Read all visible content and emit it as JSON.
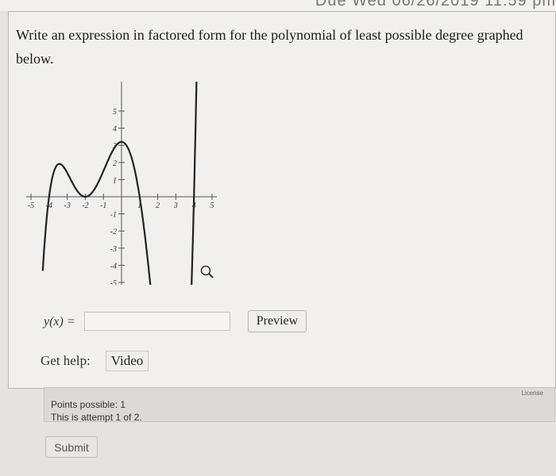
{
  "header": {
    "due_text": "Due Wed 06/26/2019 11:59 pm"
  },
  "question": {
    "text": "Write an expression in factored form for the polynomial of least possible degree graphed below.",
    "graph": {
      "x_ticks": [
        "-5",
        "-4",
        "-3",
        "-2",
        "-1",
        "1",
        "2",
        "3",
        "4",
        "5"
      ],
      "y_ticks": [
        "5",
        "4",
        "3",
        "2",
        "1",
        "-1",
        "-2",
        "-3",
        "-4",
        "-5"
      ],
      "zoom_icon": "magnifier-icon"
    }
  },
  "answer": {
    "label": "y(x) =",
    "value": "",
    "placeholder": ""
  },
  "buttons": {
    "preview": "Preview",
    "video": "Video",
    "submit": "Submit"
  },
  "help": {
    "label": "Get help:"
  },
  "info": {
    "license": "License",
    "points": "Points possible: 1",
    "attempt": "This is attempt 1 of 2."
  }
}
